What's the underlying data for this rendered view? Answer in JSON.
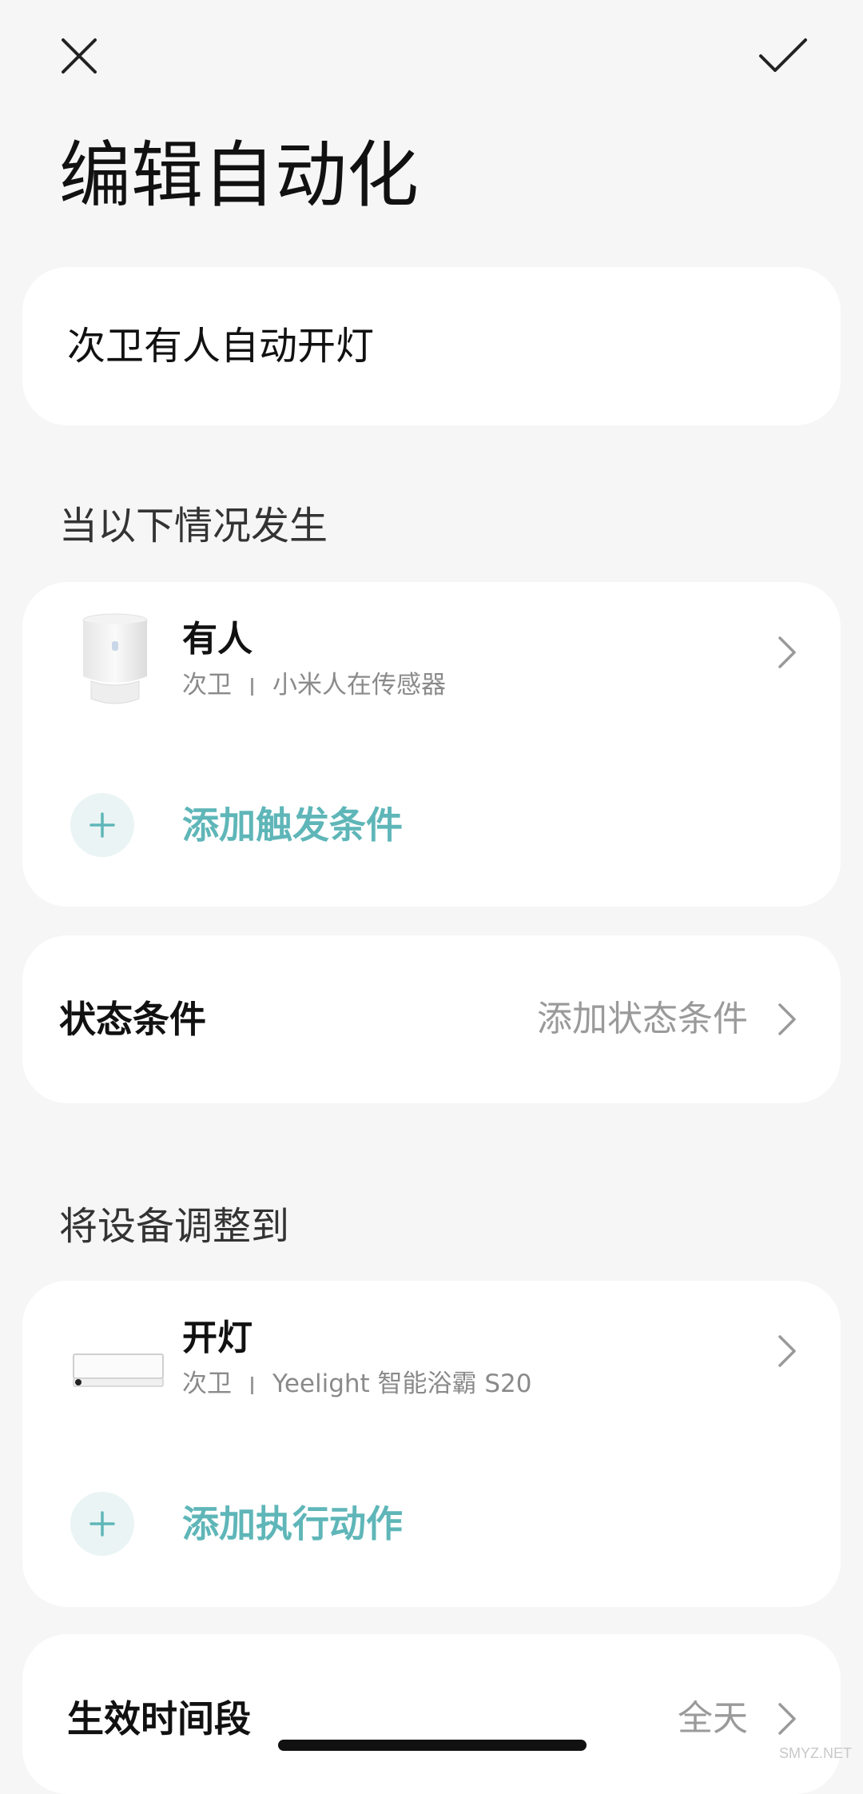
{
  "header": {
    "close_icon": "close-icon",
    "confirm_icon": "check-icon",
    "title": "编辑自动化"
  },
  "automation": {
    "name": "次卫有人自动开灯"
  },
  "trigger_section": {
    "label": "当以下情况发生",
    "items": [
      {
        "title": "有人",
        "room": "次卫",
        "device": "小米人在传感器",
        "icon": "motion-sensor-image"
      }
    ],
    "add_label": "添加触发条件"
  },
  "condition_section": {
    "title": "状态条件",
    "value": "添加状态条件"
  },
  "action_section": {
    "label": "将设备调整到",
    "items": [
      {
        "title": "开灯",
        "room": "次卫",
        "device": "Yeelight 智能浴霸 S20",
        "icon": "bath-heater-image"
      }
    ],
    "add_label": "添加执行动作"
  },
  "period_section": {
    "title": "生效时间段",
    "value": "全天"
  },
  "watermark": "SMYZ.NET",
  "colors": {
    "background": "#f6f6f6",
    "card": "#ffffff",
    "accent": "#5fb6b8",
    "secondary_text": "#8a8a8a"
  }
}
